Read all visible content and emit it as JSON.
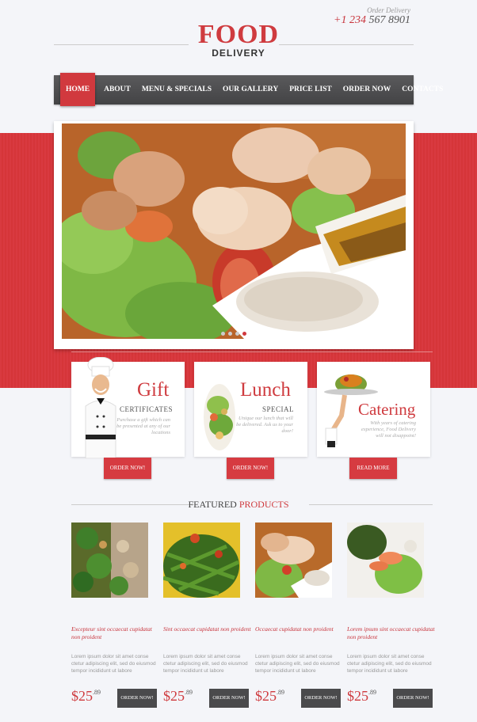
{
  "header": {
    "order_label": "Order Delivery",
    "phone_code": "+1 234",
    "phone_rest": " 567 8901",
    "logo_main": "FOOD",
    "logo_sub": "DELIVERY"
  },
  "nav": {
    "items": [
      {
        "label": "HOME",
        "active": true
      },
      {
        "label": "ABOUT"
      },
      {
        "label": "MENU & SPECIALS"
      },
      {
        "label": "OUR GALLERY"
      },
      {
        "label": "PRICE LIST"
      },
      {
        "label": "ORDER NOW"
      },
      {
        "label": "CONTACTS"
      }
    ]
  },
  "slider": {
    "dots": 4,
    "active_dot": 3
  },
  "cards": [
    {
      "title": "Gift",
      "subtitle": "CERTIFICATES",
      "text": "Purchase a gift which can be presented at any of our locations",
      "button": "ORDER NOW!"
    },
    {
      "title": "Lunch",
      "subtitle": "SPECIAL",
      "text": "Unique our lunch that will be delivered. Ask us to your door!",
      "button": "ORDER NOW!"
    },
    {
      "title": "Catering",
      "subtitle": "",
      "text": "With years of catering experience, Food Delivery will not disappoint!",
      "button": "READ MORE"
    }
  ],
  "featured": {
    "title_plain": "FEATURED ",
    "title_accent": "PRODUCTS"
  },
  "products": [
    {
      "name": "Excepteur sint occaecat cupidatat non proident",
      "desc": "Lorem ipsum dolor sit amet conse ctetur adipiscing elit, sed do eiusmod tempor incididunt ut labore",
      "price": "$25",
      "cents": ".89",
      "button": "ORDER NOW!"
    },
    {
      "name": "Sint occaecat cupidatat non proident",
      "desc": "Lorem ipsum dolor sit amet conse ctetur adipiscing elit, sed do eiusmod tempor incididunt ut labore",
      "price": "$25",
      "cents": ".89",
      "button": "ORDER NOW!"
    },
    {
      "name": "Occaecat cupidatat non proident",
      "desc": "Lorem ipsum dolor sit amet conse ctetur adipiscing elit, sed do eiusmod tempor incididunt ut labore",
      "price": "$25",
      "cents": ".89",
      "button": "ORDER NOW!"
    },
    {
      "name": "Lorem ipsum sint occaecat cupidatat non proident",
      "desc": "Lorem ipsum dolor sit amet conse ctetur adipiscing elit, sed do eiusmod tempor incididunt ut labore",
      "price": "$25",
      "cents": ".89",
      "button": "ORDER NOW!"
    }
  ],
  "colors": {
    "accent": "#cf3b3f",
    "nav_bg": "#4e4e50",
    "page_bg": "#f4f5f9"
  }
}
